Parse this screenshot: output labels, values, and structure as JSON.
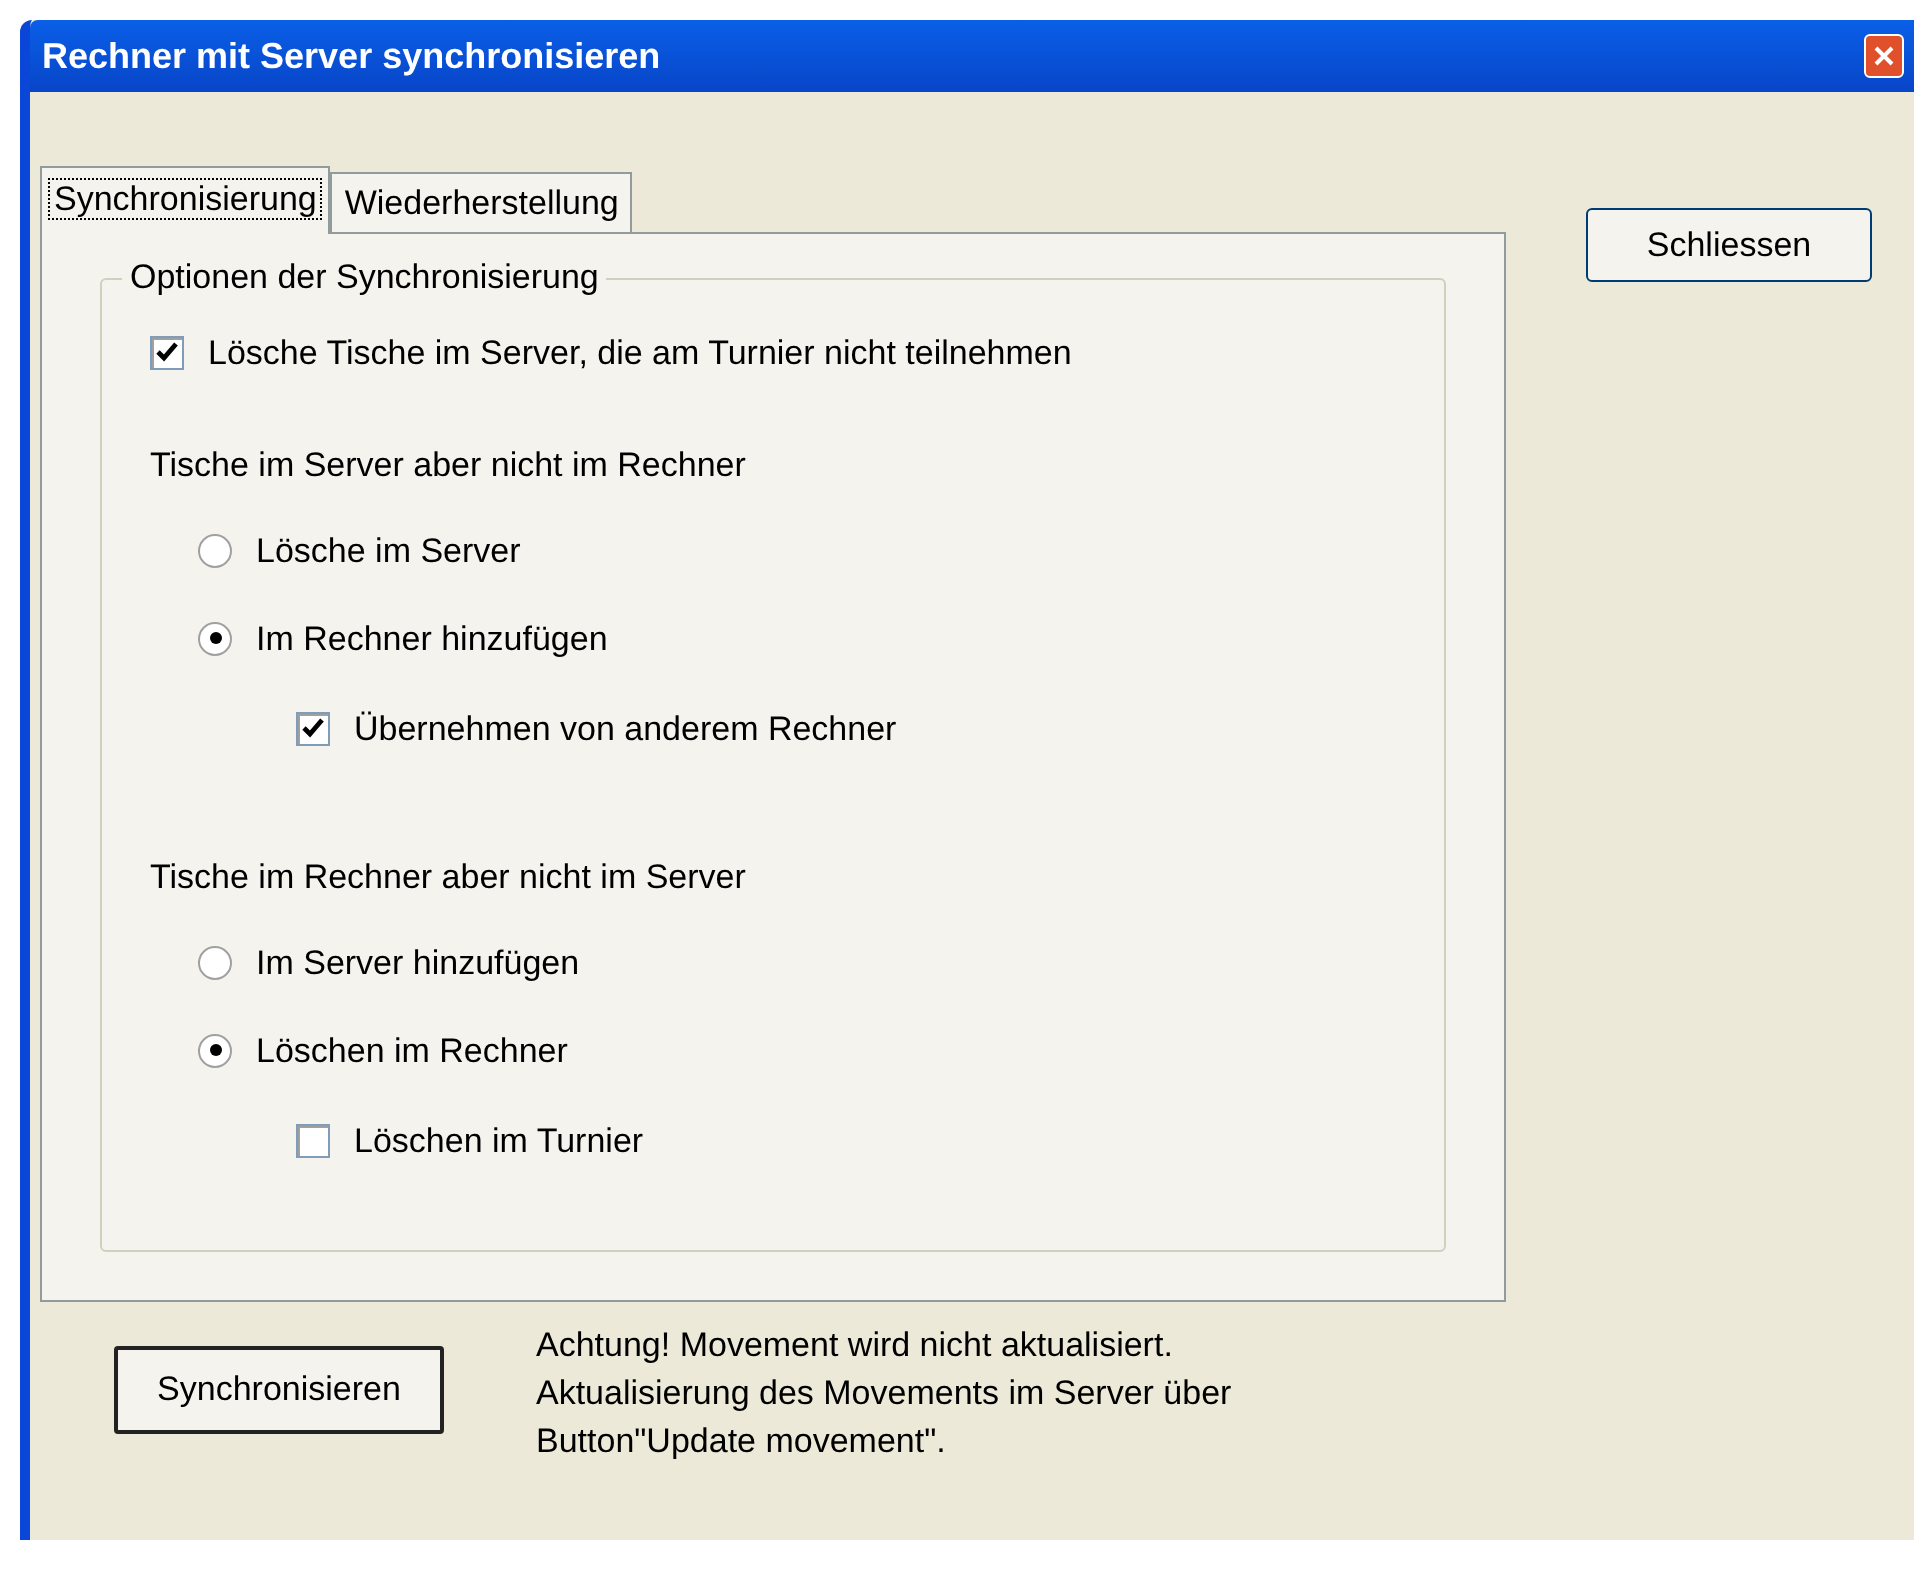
{
  "window": {
    "title": "Rechner mit Server synchronisieren"
  },
  "tabs": [
    {
      "label": "Synchronisierung",
      "selected": true
    },
    {
      "label": "Wiederherstellung",
      "selected": false
    }
  ],
  "group": {
    "title": "Optionen der Synchronisierung",
    "option": {
      "label": "Lösche Tische im Server, die am Turnier nicht teilnehmen",
      "checked": true
    },
    "sections": [
      {
        "heading": "Tische im Server aber nicht im Rechner",
        "options": [
          {
            "label": "Lösche im Server",
            "selected": false
          },
          {
            "label": "Im Rechner hinzufügen",
            "selected": true,
            "children": [
              {
                "label": "Übernehmen von anderem Rechner",
                "checked": true
              }
            ]
          }
        ]
      },
      {
        "heading": "Tische im Rechner aber nicht im Server",
        "options": [
          {
            "label": "Im Server hinzufügen",
            "selected": false
          },
          {
            "label": "Löschen im Rechner",
            "selected": true,
            "children": [
              {
                "label": "Löschen im Turnier",
                "checked": false
              }
            ]
          }
        ]
      }
    ]
  },
  "sync_button": "Synchronisieren",
  "note": "Achtung! Movement wird nicht aktualisiert. Aktualisierung des Movements im Server über Button\"Update movement\".",
  "close_button": "Schliessen"
}
